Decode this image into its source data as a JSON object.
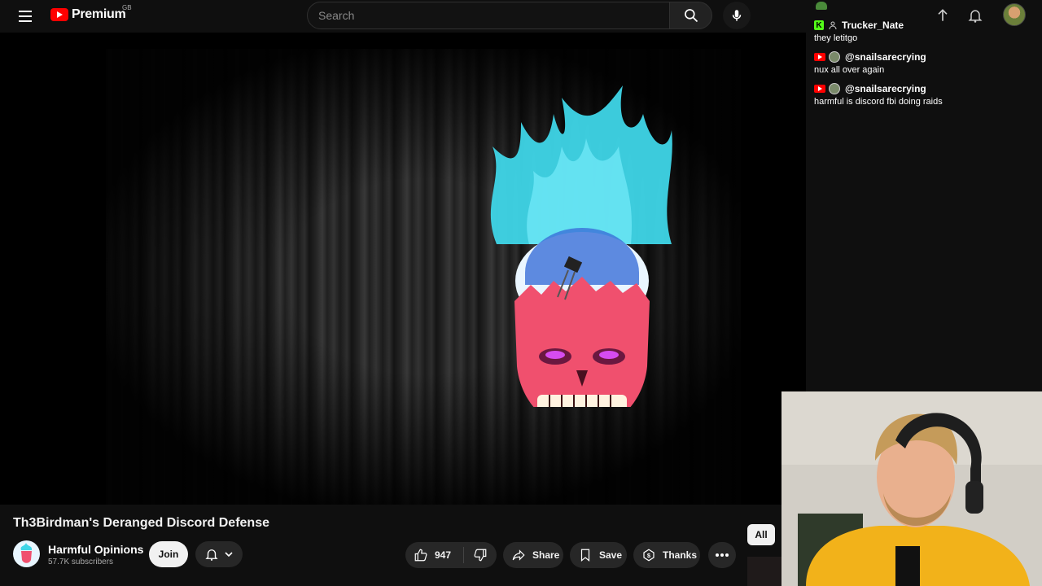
{
  "header": {
    "logo_text": "Premium",
    "country_code": "GB",
    "search_placeholder": "Search"
  },
  "chat": {
    "messages": [
      {
        "username": "Trucker_Nate",
        "text": "they letitgo",
        "platform": "kick"
      },
      {
        "username": "@snailsarecrying",
        "text": "nux all over again",
        "platform": "youtube"
      },
      {
        "username": "@snailsarecrying",
        "text": "harmful is discord fbi doing raids",
        "platform": "youtube"
      }
    ]
  },
  "video": {
    "title": "Th3Birdman's Deranged Discord Defense",
    "channel_name": "Harmful Opinions",
    "subscribers": "57.7K subscribers",
    "join_label": "Join",
    "like_count": "947",
    "share_label": "Share",
    "save_label": "Save",
    "thanks_label": "Thanks"
  },
  "sidebar": {
    "chip_all": "All"
  },
  "colors": {
    "background": "#0f0f0f",
    "brand_red": "#ff0000",
    "pill_bg": "#272727",
    "skull_flame": "#3fd6e8",
    "skull_face": "#f0506e",
    "kick_green": "#53fc18"
  }
}
